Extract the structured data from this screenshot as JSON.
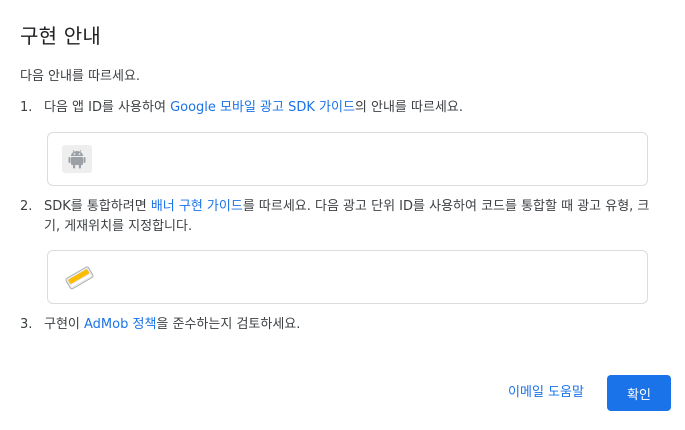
{
  "dialog": {
    "title": "구현 안내",
    "intro": "다음 안내를 따르세요."
  },
  "steps": [
    {
      "number": "1.",
      "before": "다음 앱 ID를 사용하여 ",
      "link": "Google 모바일 광고 SDK 가이드",
      "after": "의 안내를 따르세요.",
      "box_icon": "android-icon"
    },
    {
      "number": "2.",
      "before": "SDK를 통합하려면 ",
      "link": "배너 구현 가이드",
      "after": "를 따르세요. 다음 광고 단위 ID를 사용하여 코드를 통합할 때 광고 유형, 크기, 게재위치를 지정합니다.",
      "box_icon": "ad-unit-icon"
    },
    {
      "number": "3.",
      "before": "구현이 ",
      "link": "AdMob 정책",
      "after": "을 준수하는지 검토하세요."
    }
  ],
  "footer": {
    "help_link": "이메일 도움말",
    "confirm_label": "확인"
  },
  "colors": {
    "link": "#1a73e8",
    "primary_button": "#1a73e8",
    "text": "#3c4043",
    "border": "#dadce0"
  }
}
